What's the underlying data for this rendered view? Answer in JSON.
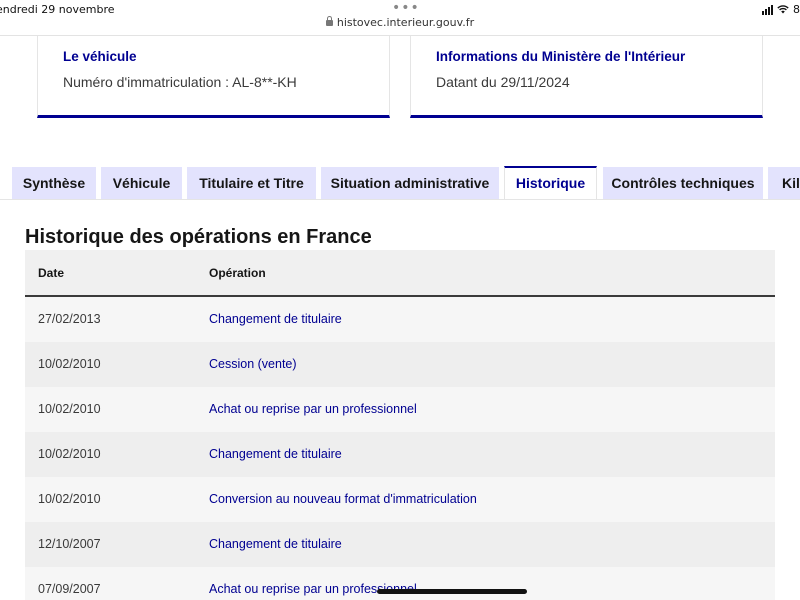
{
  "statusbar": {
    "date": "endredi 29 novembre",
    "battery": "8"
  },
  "browser": {
    "url": "histovec.interieur.gouv.fr",
    "menu_dots": "•••"
  },
  "cards": [
    {
      "title": "Le véhicule",
      "subtitle": "Numéro d'immatriculation : AL-8**-KH"
    },
    {
      "title": "Informations du Ministère de l'Intérieur",
      "subtitle": "Datant du 29/11/2024"
    }
  ],
  "tabs": [
    {
      "label": "Synthèse",
      "active": false
    },
    {
      "label": "Véhicule",
      "active": false
    },
    {
      "label": "Titulaire et Titre",
      "active": false
    },
    {
      "label": "Situation administrative",
      "active": false
    },
    {
      "label": "Historique",
      "active": true
    },
    {
      "label": "Contrôles techniques",
      "active": false
    },
    {
      "label": "Kil",
      "active": false
    }
  ],
  "section": {
    "title": "Historique des opérations en France"
  },
  "table": {
    "headers": {
      "date": "Date",
      "operation": "Opération"
    },
    "rows": [
      {
        "date": "27/02/2013",
        "operation": "Changement de titulaire"
      },
      {
        "date": "10/02/2010",
        "operation": "Cession (vente)"
      },
      {
        "date": "10/02/2010",
        "operation": "Achat ou reprise par un professionnel"
      },
      {
        "date": "10/02/2010",
        "operation": "Changement de titulaire"
      },
      {
        "date": "10/02/2010",
        "operation": "Conversion au nouveau format d'immatriculation"
      },
      {
        "date": "12/10/2007",
        "operation": "Changement de titulaire"
      },
      {
        "date": "07/09/2007",
        "operation": "Achat ou reprise par un professionnel"
      }
    ]
  },
  "colors": {
    "brand_blue": "#000091",
    "tab_background": "#e3e3fd"
  }
}
